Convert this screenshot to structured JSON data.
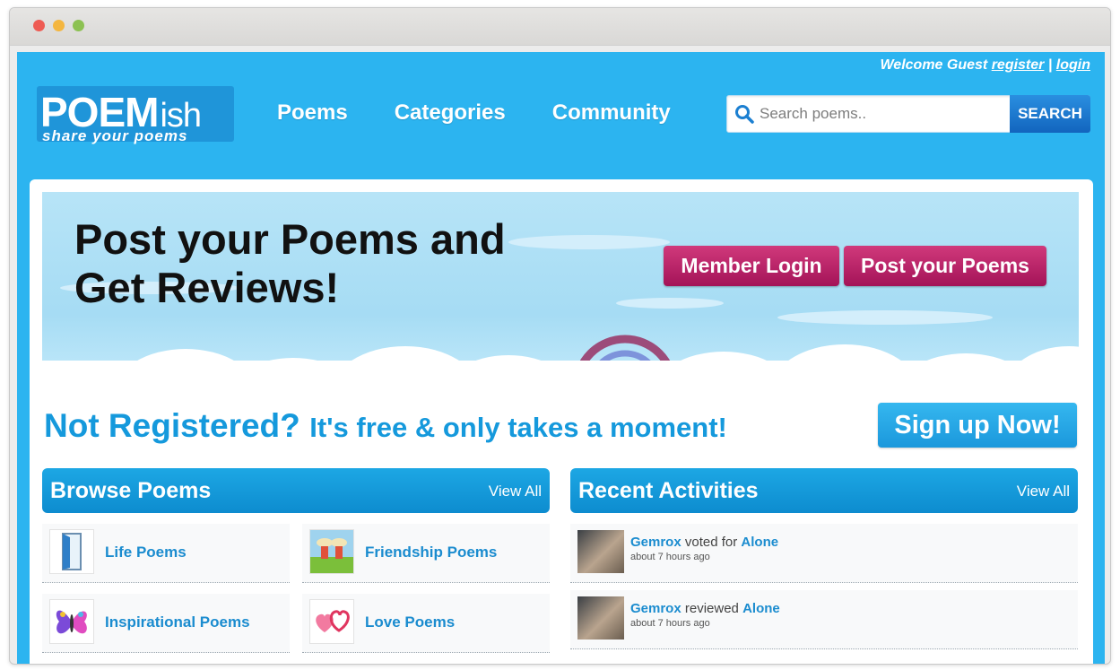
{
  "header": {
    "welcome_prefix": "Welcome Guest",
    "register_label": "register",
    "separator": "|",
    "login_label": "login",
    "logo_main": "POEM",
    "logo_ish": "ish",
    "logo_tagline": "share your poems",
    "nav": [
      "Poems",
      "Categories",
      "Community"
    ],
    "search_placeholder": "Search poems..",
    "search_button": "SEARCH"
  },
  "hero": {
    "title_line1": "Post your Poems and",
    "title_line2": "Get Reviews!",
    "member_login": "Member Login",
    "post_poems": "Post your Poems"
  },
  "signup_bar": {
    "not_registered": "Not Registered?",
    "tagline": "It's free & only takes a moment!",
    "signup_button": "Sign up Now!"
  },
  "browse": {
    "title": "Browse Poems",
    "view_all": "View All",
    "categories": [
      {
        "label": "Life Poems",
        "icon": "door-icon"
      },
      {
        "label": "Friendship Poems",
        "icon": "friends-icon"
      },
      {
        "label": "Inspirational Poems",
        "icon": "butterfly-icon"
      },
      {
        "label": "Love Poems",
        "icon": "hearts-icon"
      }
    ]
  },
  "activities": {
    "title": "Recent Activities",
    "view_all": "View All",
    "items": [
      {
        "user": "Gemrox",
        "action": "voted for",
        "target": "Alone",
        "time": "about 7 hours ago"
      },
      {
        "user": "Gemrox",
        "action": "reviewed",
        "target": "Alone",
        "time": "about 7 hours ago"
      }
    ]
  },
  "colors": {
    "page_background": "#2cb4f0",
    "accent_blue": "#1599dc",
    "hero_button": "#b81f66",
    "panel_header": "#1598d9"
  }
}
